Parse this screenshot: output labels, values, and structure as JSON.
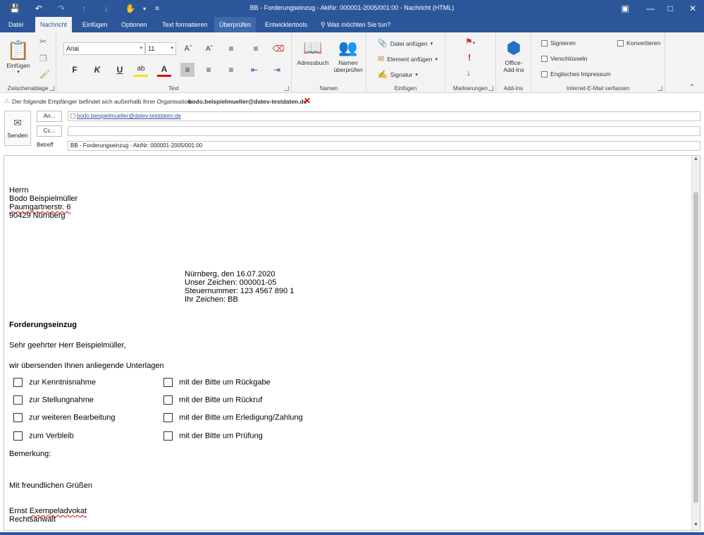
{
  "window": {
    "title": "BB - Forderungseinzug - AktNr: 000001-2005/001:00 - Nachricht (HTML)"
  },
  "tabs": [
    {
      "label": "Datei"
    },
    {
      "label": "Nachricht"
    },
    {
      "label": "Einfügen"
    },
    {
      "label": "Optionen"
    },
    {
      "label": "Text formatieren"
    },
    {
      "label": "Überprüfen"
    },
    {
      "label": "Entwicklertools"
    }
  ],
  "tell_me": "Was möchten Sie tun?",
  "ribbon": {
    "clipboard": {
      "paste_label": "Einfügen",
      "group_label": "Zwischenablage"
    },
    "text": {
      "font": "Arial",
      "size": "11",
      "group_label": "Text",
      "bold": "F",
      "italic": "K",
      "underline": "U"
    },
    "names": {
      "address_book": "Adressbuch",
      "check_names_1": "Namen",
      "check_names_2": "überprüfen",
      "group_label": "Namen"
    },
    "include": {
      "attach_file": "Datei anfügen",
      "attach_item": "Element anfügen",
      "signature": "Signatur",
      "group_label": "Einfügen"
    },
    "tags": {
      "group_label": "Markierungen"
    },
    "addins": {
      "office_addins_1": "Office-",
      "office_addins_2": "Add-Ins",
      "group_label": "Add-Ins"
    },
    "internet": {
      "sign": "Signieren",
      "encrypt": "Verschlüsseln",
      "english": "Englisches Impressum",
      "convert": "Konvertieren",
      "group_label": "Internet-E-Mail verfassen"
    }
  },
  "info_bar": {
    "text": "Der folgende Empfänger befindet sich außerhalb Ihrer Organisation:",
    "recipient": "bodo.beispielmueller@datev-testdaten.de"
  },
  "header": {
    "send": "Senden",
    "to_button": "An...",
    "cc_button": "Cc...",
    "subject_label": "Betreff",
    "to_value": "bodo.beispielmueller@datev-testdaten.de",
    "cc_value": "",
    "subject_value": "BB - Forderungseinzug - AktNr: 000001-2005/001:00"
  },
  "letter": {
    "address": [
      "Herrn",
      "Bodo Beispielmüller",
      "Paumgartnerstr. 6",
      "90429 Nürnberg"
    ],
    "info": [
      "Nürnberg, den 16.07.2020",
      "Unser Zeichen: 000001-05",
      "Steuernummer: 123 4567 890 1",
      "Ihr Zeichen: BB"
    ],
    "subject": "Forderungseinzug",
    "salutation": "Sehr geehrter Herr Beispielmüller,",
    "intro": "wir übersenden Ihnen anliegende Unterlagen",
    "checks_left": [
      "zur Kenntnisnahme",
      "zur Stellungnahme",
      "zur weiteren Bearbeitung",
      "zum Verbleib"
    ],
    "checks_right": [
      "mit der Bitte um Rückgabe",
      "mit der Bitte um Rückruf",
      "mit der Bitte um Erledigung/Zahlung",
      "mit der Bitte um Prüfung"
    ],
    "remark": "Bemerkung:",
    "closing": "Mit freundlichen Grüßen",
    "signer_first": "Ernst",
    "signer_last": "Exempeladvokat",
    "role": "Rechtsanwalt"
  },
  "colors": {
    "accent": "#2b579a"
  }
}
